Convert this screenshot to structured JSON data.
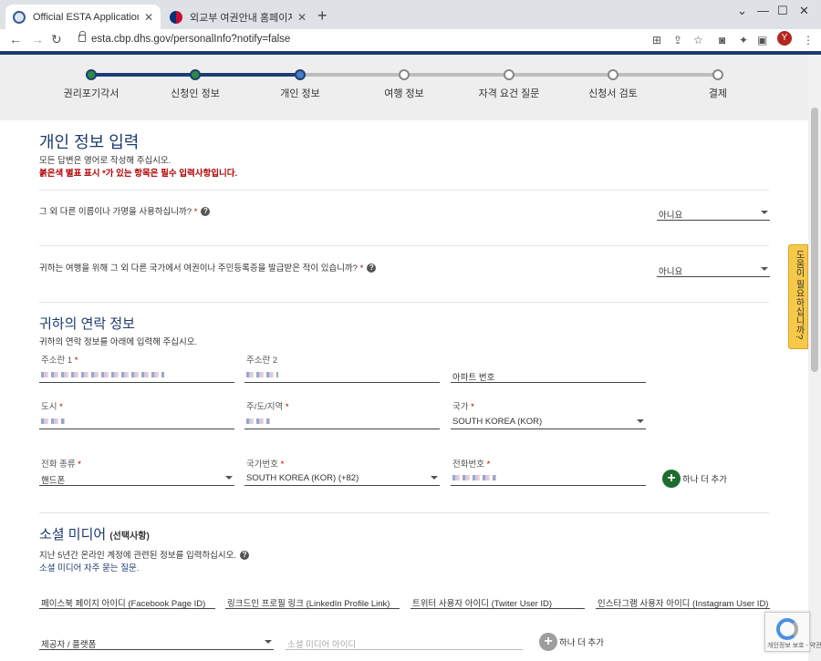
{
  "browser": {
    "tabs": [
      {
        "title": "Official ESTA Application Websi",
        "active": true
      },
      {
        "title": "외교부 여권안내 홈페이지",
        "active": false
      }
    ],
    "url": "esta.cbp.dhs.gov/personalInfo?notify=false",
    "profile_initial": "Y"
  },
  "stepper": {
    "steps": [
      {
        "label": "권리포기각서",
        "state": "done"
      },
      {
        "label": "신청인 정보",
        "state": "done"
      },
      {
        "label": "개인 정보",
        "state": "current"
      },
      {
        "label": "여행 정보",
        "state": "todo"
      },
      {
        "label": "자격 요건 질문",
        "state": "todo"
      },
      {
        "label": "신청서 검토",
        "state": "todo"
      },
      {
        "label": "결제",
        "state": "todo"
      }
    ],
    "colors": {
      "done": "#2e8b3e",
      "current": "#4a7bc0",
      "line": "#1a3f77",
      "todo": "#bdbdbd"
    }
  },
  "personal": {
    "title": "개인 정보 입력",
    "note": "모든 답변은 영어로 작성해 주십시오.",
    "required_note": "붉은색 별표 표시 *가 있는 항목은 필수 입력사항입니다.",
    "q_other_names": "그 외 다른 이름이나 가명을 사용하십니까?",
    "q_other_names_value": "아니요",
    "q_other_passport": "귀하는 여행을 위해 그 외 다른 국가에서 여권이나 주민등록증을 발급받은 적이 있습니까?",
    "q_other_passport_value": "아니요"
  },
  "contact": {
    "title": "귀하의 연락 정보",
    "note": "귀하의 연락 정보를 아래에 입력해 주십시오.",
    "address1_label": "주소란 1",
    "address2_label": "주소란 2",
    "apt_placeholder": "아파트 번호",
    "city_label": "도시",
    "state_label": "주/도/지역",
    "country_label": "국가",
    "country_value": "SOUTH KOREA (KOR)",
    "phone_type_label": "전화 종류",
    "phone_type_value": "핸드폰",
    "country_code_label": "국가번호",
    "country_code_value": "SOUTH KOREA (KOR) (+82)",
    "phone_label": "전화번호",
    "add_more": "하나 더 추가"
  },
  "social": {
    "title": "소셜 미디어",
    "optional": "(선택사항)",
    "note": "지난 5년간 온라인 계정에 관련된 정보를 입력하십시오.",
    "faq_link": "소셜 미디어 자주 묻는 질문.",
    "facebook": "페이스북 페이지 아이디 (Facebook Page ID)",
    "linkedin": "링크드인 프로필 링크 (LinkedIn Profile Link)",
    "twitter": "트위터 사용자 아이디 (Twiter User ID)",
    "instagram": "인스타그램 사용자 아이디 (Instagram User ID)",
    "provider_placeholder": "제공자 / 플랫폼",
    "social_id_placeholder": "소셜 미디어 아이디",
    "add_more": "하나 더 추가"
  },
  "help_tab": "도움이 필요하십니까?",
  "recaptcha_text": "개인정보 보호 - 약관"
}
